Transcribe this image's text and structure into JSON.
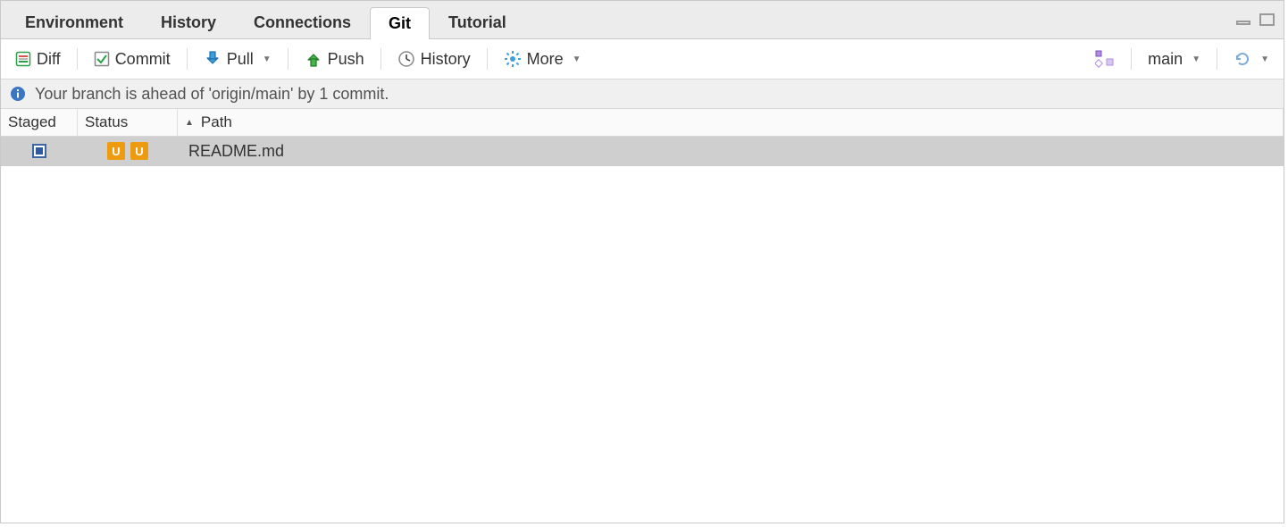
{
  "tabs": [
    {
      "label": "Environment",
      "active": false
    },
    {
      "label": "History",
      "active": false
    },
    {
      "label": "Connections",
      "active": false
    },
    {
      "label": "Git",
      "active": true
    },
    {
      "label": "Tutorial",
      "active": false
    }
  ],
  "toolbar": {
    "diff": "Diff",
    "commit": "Commit",
    "pull": "Pull",
    "push": "Push",
    "history": "History",
    "more": "More",
    "branch": "main"
  },
  "status_message": "Your branch is ahead of 'origin/main' by 1 commit.",
  "columns": {
    "staged": "Staged",
    "status": "Status",
    "path": "Path"
  },
  "rows": [
    {
      "staged": true,
      "status_left": "U",
      "status_right": "U",
      "path": "README.md"
    }
  ]
}
